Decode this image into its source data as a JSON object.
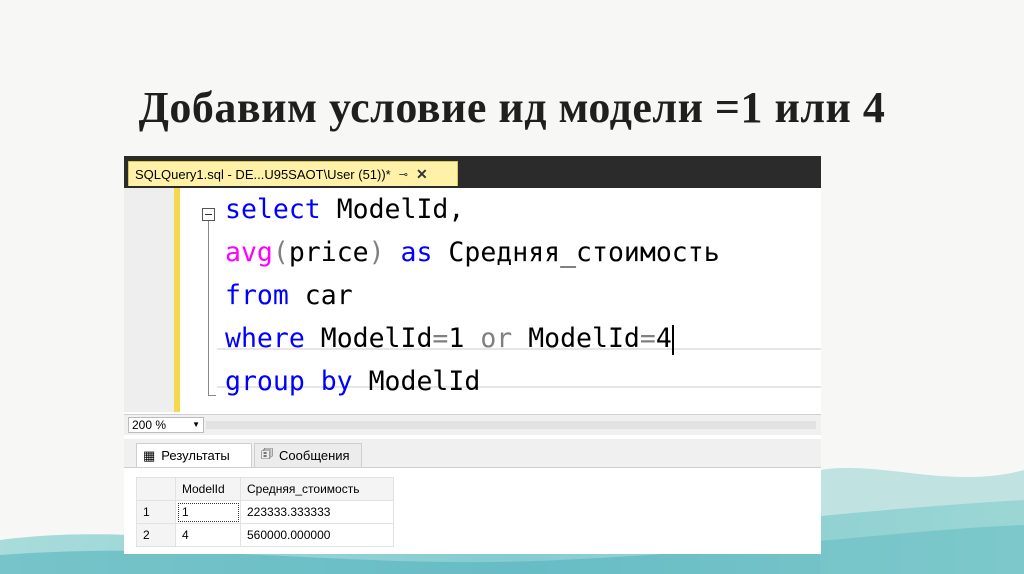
{
  "slide": {
    "title": "Добавим условие ид модели =1 или 4"
  },
  "window": {
    "tab_title": "SQLQuery1.sql - DE...U95SAOT\\User (51))*",
    "pin_icon": "pin-icon",
    "close_icon": "close-icon"
  },
  "editor": {
    "lines": [
      {
        "kw1": "select",
        "rest": " ModelId,"
      },
      {
        "fn": "avg",
        "p1": "(",
        "mid": "price",
        "p2": ")",
        "kw": " as",
        "rest": " Средняя_стоимость"
      },
      {
        "kw": "from",
        "rest": " car"
      },
      {
        "kw": "where",
        "a": " ModelId",
        "eq1": "=",
        "b": "1 ",
        "or": "or",
        "c": " ModelId",
        "eq2": "=",
        "d": "4"
      },
      {
        "kw": "group by",
        "rest": " ModelId"
      }
    ],
    "colors": {
      "keyword": "#0000ff",
      "function": "#ff00ff",
      "operator": "#808080"
    }
  },
  "zoom": {
    "value": "200 %"
  },
  "results": {
    "tabs": [
      {
        "label": "Результаты",
        "icon": "grid-icon"
      },
      {
        "label": "Сообщения",
        "icon": "messages-icon"
      }
    ],
    "columns": [
      "ModelId",
      "Средняя_стоимость"
    ],
    "rows": [
      {
        "num": "1",
        "ModelId": "1",
        "avg": "223333.333333"
      },
      {
        "num": "2",
        "ModelId": "4",
        "avg": "560000.000000"
      }
    ]
  }
}
